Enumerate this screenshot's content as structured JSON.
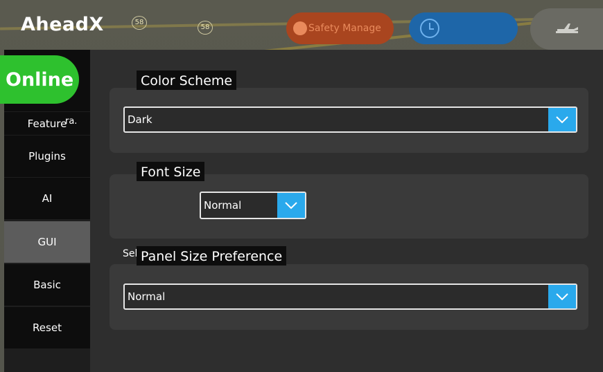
{
  "app": {
    "brand": "AheadX"
  },
  "map": {
    "route_badges": [
      "58",
      "58"
    ]
  },
  "topbar": {
    "safety_label": "Safety Manage",
    "clock_icon": "clock-icon",
    "plane_icon": "plane-icon"
  },
  "status": {
    "online_label": "Online"
  },
  "sidebar": {
    "partial_label": "ra.",
    "items": [
      {
        "label": "Feature"
      },
      {
        "label": "Plugins"
      },
      {
        "label": "AI"
      },
      {
        "label": "GUI",
        "active": true
      },
      {
        "label": "Basic"
      },
      {
        "label": "Reset"
      }
    ]
  },
  "settings": {
    "color_scheme": {
      "title": "Color Scheme",
      "value": "Dark"
    },
    "font_size": {
      "title": "Font Size",
      "select_label": "Select:",
      "value": "Normal"
    },
    "panel_size": {
      "title": "Panel Size Preference",
      "value": "Normal"
    }
  },
  "colors": {
    "accent": "#2aa9ec",
    "online": "#2ec12e",
    "safety_pill": "#a9451f",
    "clock_pill": "#1e66a8"
  }
}
